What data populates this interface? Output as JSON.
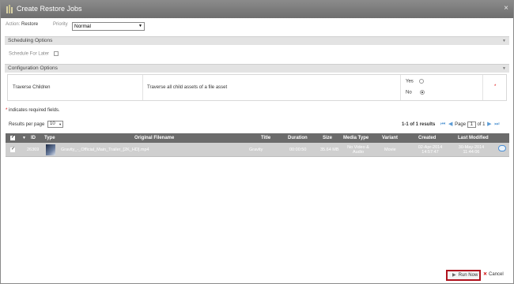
{
  "window": {
    "title": "Create Restore Jobs",
    "close_glyph": "×"
  },
  "header": {
    "action_label": "Action:",
    "action_value": "Restore",
    "priority_label": "Priority",
    "priority_value": "Normal"
  },
  "sections": {
    "scheduling": {
      "title": "Scheduling Options",
      "schedule_later_label": "Schedule For Later"
    },
    "configuration": {
      "title": "Configuration Options",
      "option_name": "Traverse Children",
      "option_desc": "Traverse all child assets of a file asset",
      "yes_label": "Yes",
      "no_label": "No",
      "selected": "No",
      "required_mark": "*"
    }
  },
  "required_note": {
    "mark": "*",
    "text": "indicates required fields."
  },
  "results": {
    "per_page_label": "Results per page",
    "per_page_value": "10",
    "summary": "1-1 of 1 results",
    "page_label": "Page",
    "page_value": "1",
    "of_label": "of 1"
  },
  "grid": {
    "columns": [
      "ID",
      "Type",
      "Original Filename",
      "Title",
      "Duration",
      "Size",
      "Media Type",
      "Variant",
      "Created",
      "Last Modified"
    ],
    "rows": [
      {
        "id": "26369",
        "filename": "Gravity_-_Official_Main_Trailer_[2K_HD].mp4",
        "title": "Gravity",
        "duration": "00:00:50",
        "size": "35.64 MB",
        "media_type_1": "No Video &",
        "media_type_2": "Audio",
        "variant": "Movie",
        "created_1": "02-Apr-2014",
        "created_2": "14:57:47",
        "modified_1": "30-May-2014",
        "modified_2": "11:44:06"
      }
    ]
  },
  "footer": {
    "run_now": "Run Now",
    "cancel": "Cancel"
  },
  "colors": {
    "accent_border": "#b0131e",
    "pager_blue": "#5b9bd5",
    "required_red": "#dd0000"
  }
}
